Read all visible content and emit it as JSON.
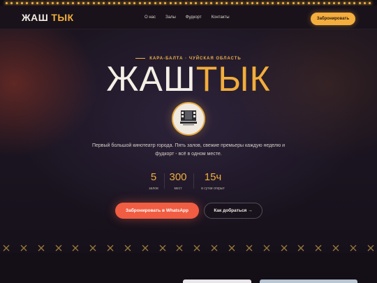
{
  "header": {
    "logo_part1": "ЖАШ",
    "logo_part2": "ТЫК",
    "nav": [
      "О нас",
      "Залы",
      "Фудкорт",
      "Контакты"
    ],
    "book_button": "Забронировать"
  },
  "hero": {
    "eyebrow": "КАРА-БАЛТА · ЧУЙСКАЯ ОБЛАСТЬ",
    "title_part1": "ЖАШ",
    "title_part2": "ТЫК",
    "badge_icon": "cinema-logo-icon",
    "description": "Первый большой кинотеатр города. Пять залов, свежие премьеры каждую неделю и фудкорт - всё в одном месте.",
    "stats": [
      {
        "value": "5",
        "label": "залов"
      },
      {
        "value": "300",
        "label": "мест"
      },
      {
        "value": "15ч",
        "label": "в сутки открыт"
      }
    ],
    "whatsapp_button": "Забронировать в WhatsApp",
    "route_button": "Как добраться →"
  },
  "colors": {
    "accent": "#f2ad3c",
    "cta": "#f05d42",
    "background": "#17111c"
  }
}
